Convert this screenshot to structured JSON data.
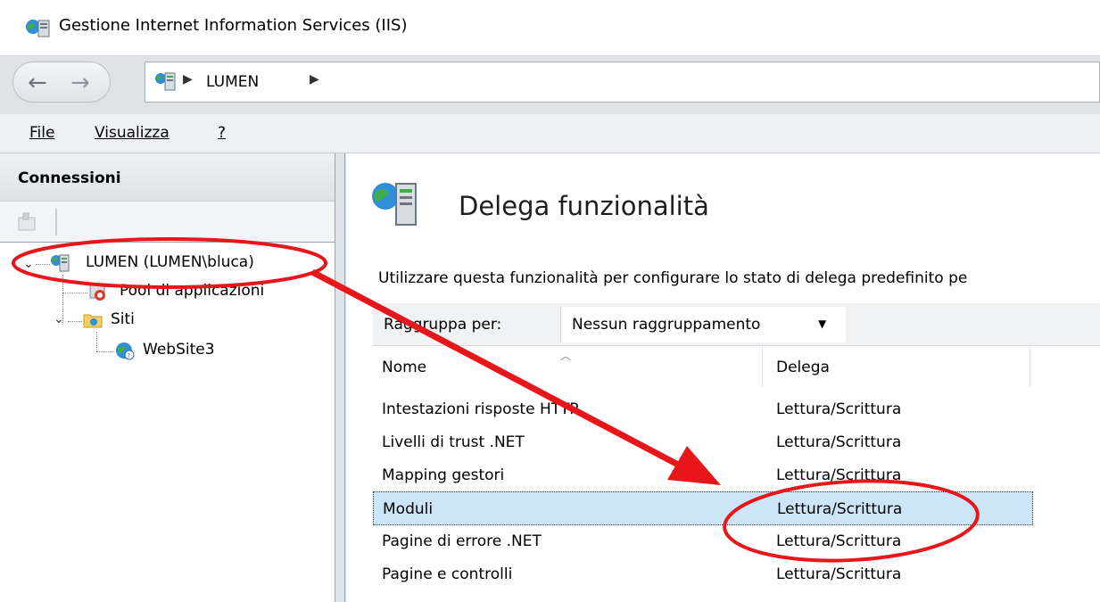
{
  "window": {
    "title": "Gestione Internet Information Services (IIS)"
  },
  "address": {
    "crumbs": [
      "LUMEN"
    ]
  },
  "menu": {
    "items": [
      "File",
      "Visualizza",
      "?"
    ]
  },
  "connections": {
    "header": "Connessioni",
    "tree": {
      "server": "LUMEN (LUMEN\\bluca)",
      "app_pools": "Pool di applicazioni",
      "sites": "Siti",
      "site_items": [
        "WebSite3"
      ]
    }
  },
  "main": {
    "title": "Delega funzionalità",
    "description": "Utilizzare questa funzionalità per configurare lo stato di delega predefinito pe",
    "group_by_label": "Raggruppa per:",
    "group_by_value": "Nessun raggruppamento",
    "columns": [
      "Nome",
      "Delega"
    ],
    "rows": [
      {
        "name": "Intestazioni risposte HTTP",
        "delegation": "Lettura/Scrittura"
      },
      {
        "name": "Livelli di trust .NET",
        "delegation": "Lettura/Scrittura"
      },
      {
        "name": "Mapping gestori",
        "delegation": "Lettura/Scrittura"
      },
      {
        "name": "Moduli",
        "delegation": "Lettura/Scrittura"
      },
      {
        "name": "Pagine di errore .NET",
        "delegation": "Lettura/Scrittura"
      },
      {
        "name": "Pagine e controlli",
        "delegation": "Lettura/Scrittura"
      }
    ],
    "selected_row": "Moduli"
  },
  "colors": {
    "annotation_red": "#e8161b",
    "selection": "#cde6f7",
    "chrome": "#dfe3e8"
  }
}
